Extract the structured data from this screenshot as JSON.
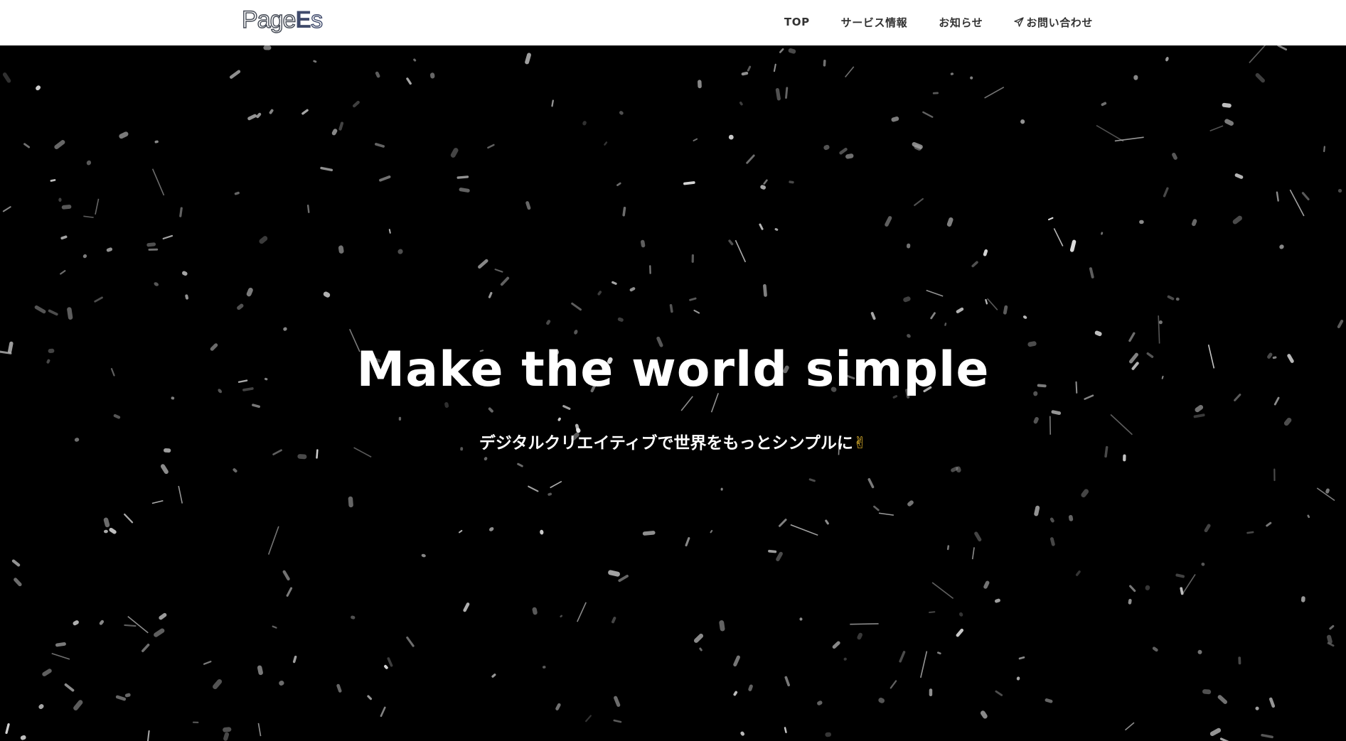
{
  "header": {
    "logo": {
      "text_page": "Page",
      "text_es_e": "E",
      "text_es_s": "s"
    },
    "nav": [
      {
        "label": "TOP",
        "icon": null
      },
      {
        "label": "サービス情報",
        "icon": null
      },
      {
        "label": "お知らせ",
        "icon": null
      },
      {
        "label": "お問い合わせ",
        "icon": "paper-plane-icon"
      }
    ]
  },
  "hero": {
    "title": "Make the world simple",
    "subtitle": "デジタルクリエイティブで世界をもっとシンプルに",
    "subtitle_emoji": "✌"
  },
  "colors": {
    "header_bg": "#ffffff",
    "hero_bg": "#000000",
    "nav_text": "#333333",
    "logo_accent": "#3f4a6b",
    "hero_text": "#ffffff",
    "emoji": "#f2c230"
  }
}
